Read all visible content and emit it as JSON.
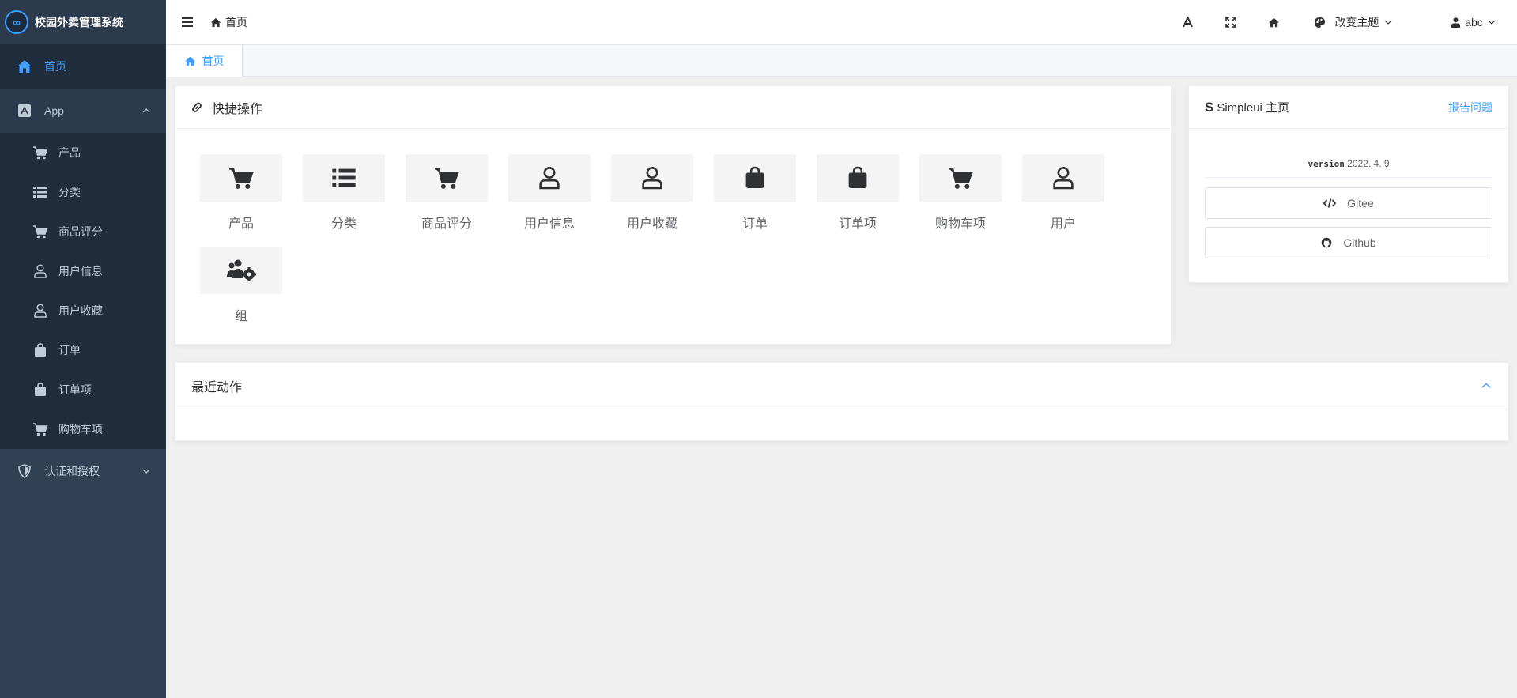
{
  "app": {
    "title": "校园外卖管理系统",
    "logo_glyph": "∞"
  },
  "sidebar": {
    "home_label": "首页",
    "app_group_label": "App",
    "app_items": [
      {
        "label": "产品",
        "icon": "cart-icon"
      },
      {
        "label": "分类",
        "icon": "list-icon"
      },
      {
        "label": "商品评分",
        "icon": "cart-icon"
      },
      {
        "label": "用户信息",
        "icon": "user-icon"
      },
      {
        "label": "用户收藏",
        "icon": "user-icon"
      },
      {
        "label": "订单",
        "icon": "bag-icon"
      },
      {
        "label": "订单项",
        "icon": "bag-icon"
      },
      {
        "label": "购物车项",
        "icon": "cart-icon"
      }
    ],
    "auth_group_label": "认证和授权"
  },
  "topbar": {
    "breadcrumb": "首页",
    "theme_label": "改变主题",
    "user_label": "abc"
  },
  "tabs": [
    {
      "label": "首页"
    }
  ],
  "quick": {
    "title": "快捷操作",
    "items": [
      {
        "label": "产品",
        "icon": "cart-icon"
      },
      {
        "label": "分类",
        "icon": "list-icon"
      },
      {
        "label": "商品评分",
        "icon": "cart-icon"
      },
      {
        "label": "用户信息",
        "icon": "user-icon"
      },
      {
        "label": "用户收藏",
        "icon": "user-icon"
      },
      {
        "label": "订单",
        "icon": "bag-icon"
      },
      {
        "label": "订单项",
        "icon": "bag-icon"
      },
      {
        "label": "购物车项",
        "icon": "cart-icon"
      },
      {
        "label": "用户",
        "icon": "user-icon"
      },
      {
        "label": "组",
        "icon": "users-gear-icon"
      }
    ]
  },
  "simpleui": {
    "title": "Simpleui 主页",
    "report_link": "报告问题",
    "version_label": "version",
    "version_value": "2022. 4. 9",
    "buttons": [
      {
        "label": "Gitee",
        "icon": "code-icon"
      },
      {
        "label": "Github",
        "icon": "github-icon"
      }
    ]
  },
  "recent": {
    "title": "最近动作"
  },
  "colors": {
    "sidebar_bg": "#304156",
    "accent": "#409eff",
    "text": "#303133"
  }
}
